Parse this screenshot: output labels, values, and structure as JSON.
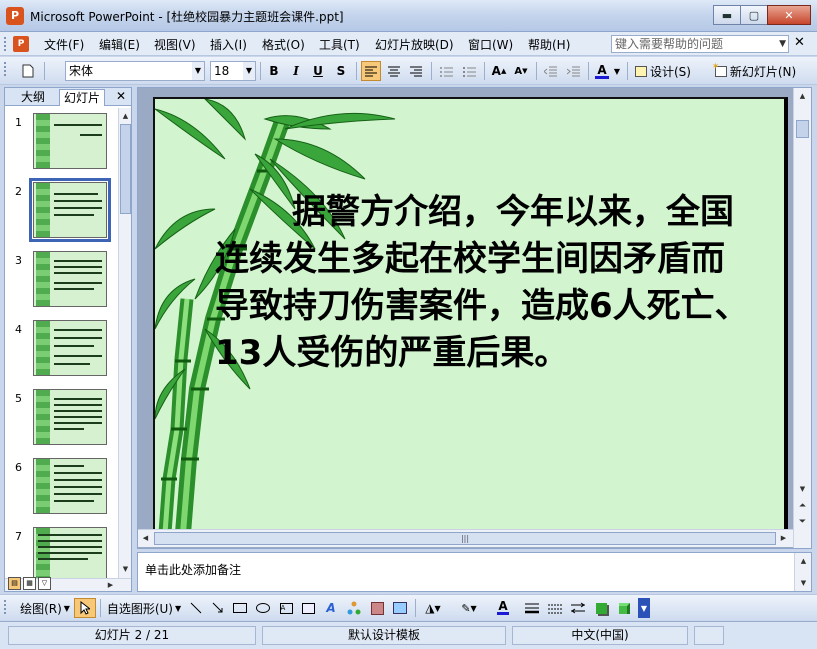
{
  "window": {
    "title": "Microsoft PowerPoint - [杜绝校园暴力主题班会课件.ppt]",
    "app_icon_label": "P",
    "minimize": "▬",
    "maximize": "▢",
    "close": "✕"
  },
  "menu": {
    "items": [
      "文件(F)",
      "编辑(E)",
      "视图(V)",
      "插入(I)",
      "格式(O)",
      "工具(T)",
      "幻灯片放映(D)",
      "窗口(W)",
      "帮助(H)"
    ],
    "help_placeholder": "键入需要帮助的问题",
    "doc_close": "✕"
  },
  "format_toolbar": {
    "font_name": "宋体",
    "font_size": "18",
    "bold": "B",
    "italic": "I",
    "underline": "U",
    "shadow": "S",
    "font_color_label": "A",
    "design_label": "设计(S)",
    "new_slide_label": "新幻灯片(N)"
  },
  "left_pane": {
    "tab_outline": "大纲",
    "tab_slides": "幻灯片",
    "close": "✕",
    "thumbnails": [
      {
        "num": "1"
      },
      {
        "num": "2"
      },
      {
        "num": "3"
      },
      {
        "num": "4"
      },
      {
        "num": "5"
      },
      {
        "num": "6"
      },
      {
        "num": "7"
      }
    ],
    "selected_index": 2
  },
  "slide": {
    "body_text": "据警方介绍，今年以来，全国连续发生多起在校学生间因矛盾而导致持刀伤害案件，造成6人死亡、13人受伤的严重后果。",
    "background_color": "#d2f5cf"
  },
  "notes": {
    "placeholder": "单击此处添加备注"
  },
  "draw_toolbar": {
    "draw_label": "绘图(R)",
    "autoshapes_label": "自选图形(U)"
  },
  "status": {
    "slide_position": "幻灯片 2 / 21",
    "template": "默认设计模板",
    "language": "中文(中国)"
  }
}
